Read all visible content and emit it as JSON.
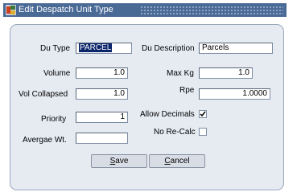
{
  "window": {
    "title": "Edit Despatch Unit Type"
  },
  "form": {
    "du_type_label": "Du Type",
    "du_type_value": "PARCEL",
    "du_description_label": "Du Description",
    "du_description_value": "Parcels",
    "volume_label": "Volume",
    "volume_value": "1.0",
    "max_kg_label": "Max Kg",
    "max_kg_value": "1.0",
    "vol_collapsed_label": "Vol Collapsed",
    "vol_collapsed_value": "1.0",
    "rpe_label": "Rpe",
    "rpe_value": "1.0000",
    "priority_label": "Priority",
    "priority_value": "1",
    "allow_decimals_label": "Allow Decimals",
    "allow_decimals_checked": true,
    "no_recalc_label": "No Re-Calc",
    "no_recalc_checked": false,
    "avergae_wt_label": "Avergae Wt.",
    "avergae_wt_value": ""
  },
  "buttons": {
    "save_rest": "ave",
    "save_mnemonic": "S",
    "cancel_rest": "ancel",
    "cancel_mnemonic": "C"
  }
}
